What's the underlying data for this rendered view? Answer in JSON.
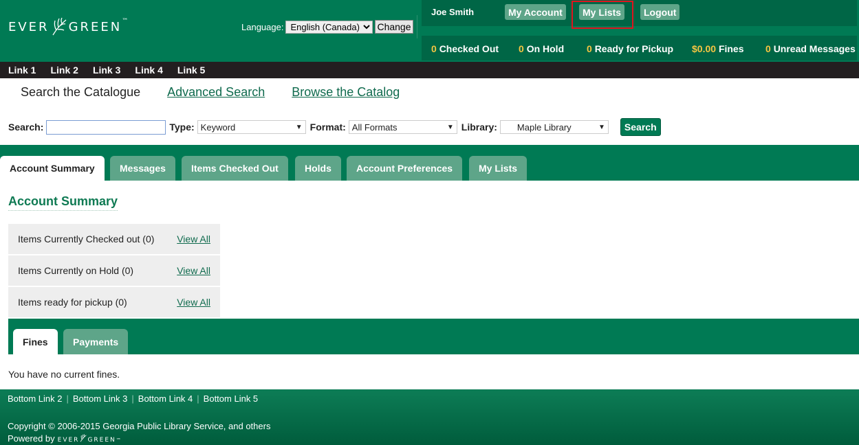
{
  "header": {
    "logo_left": "EVER",
    "logo_right": "GREEN",
    "logo_tm": "™",
    "language_label": "Language:",
    "language_value": "English (Canada)",
    "change_label": "Change",
    "user_name": "Joe Smith",
    "my_account_label": "My Account",
    "my_lists_label": "My Lists",
    "logout_label": "Logout",
    "stats": {
      "checked_out_count": "0",
      "checked_out_label": "Checked Out",
      "on_hold_count": "0",
      "on_hold_label": "On Hold",
      "ready_count": "0",
      "ready_label": "Ready for Pickup",
      "fines_amount": "$0.00",
      "fines_label": "Fines",
      "unread_count": "0",
      "unread_label": "Unread Messages"
    },
    "highlight_color": "#e0141e"
  },
  "topnav": {
    "links": [
      "Link 1",
      "Link 2",
      "Link 3",
      "Link 4",
      "Link 5"
    ]
  },
  "search": {
    "tabs": {
      "active": "Search the Catalogue",
      "advanced": "Advanced Search",
      "browse": "Browse the Catalog"
    },
    "search_label": "Search:",
    "search_value": "",
    "type_label": "Type:",
    "type_value": "Keyword",
    "format_label": "Format:",
    "format_value": "All Formats",
    "library_label": "Library:",
    "library_value": "Maple Library",
    "button_label": "Search"
  },
  "account_tabs": [
    "Account Summary",
    "Messages",
    "Items Checked Out",
    "Holds",
    "Account Preferences",
    "My Lists"
  ],
  "summary": {
    "title": "Account Summary",
    "rows": [
      {
        "label": "Items Currently Checked out (0)",
        "link": "View All"
      },
      {
        "label": "Items Currently on Hold (0)",
        "link": "View All"
      },
      {
        "label": "Items ready for pickup (0)",
        "link": "View All"
      }
    ]
  },
  "fines": {
    "tabs": [
      "Fines",
      "Payments"
    ],
    "message": "You have no current fines."
  },
  "footer": {
    "links": [
      "Bottom Link 2",
      "Bottom Link 3",
      "Bottom Link 4",
      "Bottom Link 5"
    ],
    "copyright": "Copyright © 2006-2015 Georgia Public Library Service, and others",
    "powered_by": "Powered by",
    "powered_logo_left": "EVER",
    "powered_logo_right": "GREEN",
    "powered_logo_tm": "™"
  },
  "colors": {
    "brand_green": "#007a54",
    "dark_green": "#006646",
    "tab_green": "#5ea589",
    "stat_number": "#f5c542",
    "nav_black": "#231f20"
  }
}
